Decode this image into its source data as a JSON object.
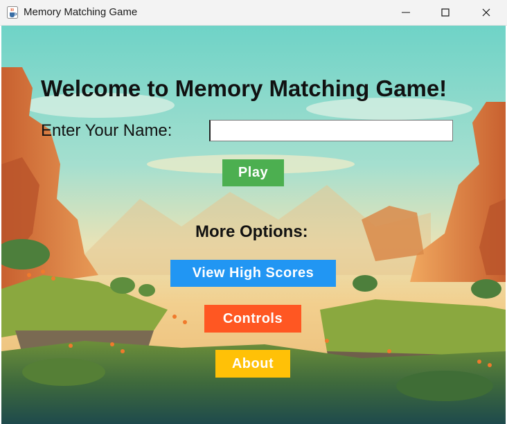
{
  "window": {
    "title": "Memory Matching Game",
    "icon": "java-cup-icon",
    "controls": [
      "minimize-icon",
      "maximize-icon",
      "close-icon"
    ]
  },
  "main": {
    "welcome_title": "Welcome to Memory Matching Game!",
    "name_label": "Enter Your Name:",
    "name_input_value": "",
    "play_label": "Play",
    "more_options_label": "More Options:",
    "high_scores_label": "View High Scores",
    "controls_label": "Controls",
    "about_label": "About"
  },
  "colors": {
    "play": "#4caf50",
    "high_scores": "#2196f3",
    "controls": "#ff5722",
    "about": "#ffc107"
  }
}
